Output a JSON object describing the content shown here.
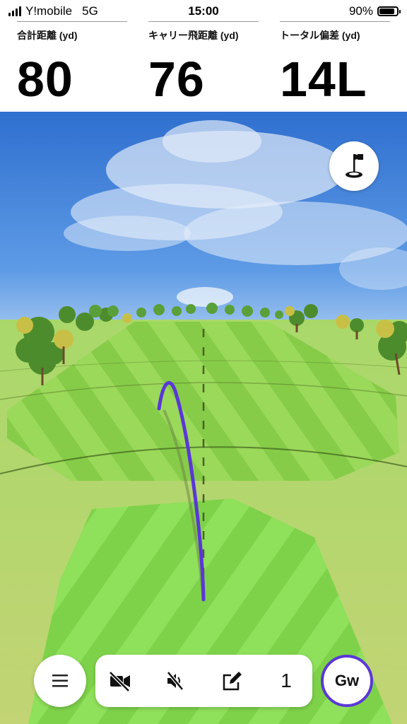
{
  "status_bar": {
    "carrier": "Y!mobile",
    "network": "5G",
    "time": "15:00",
    "battery": "90%",
    "battery_level": 0.9
  },
  "stats": [
    {
      "label": "合計距離 (yd)",
      "value": "80"
    },
    {
      "label": "キャリー飛距離 (yd)",
      "value": "76"
    },
    {
      "label": "トータル偏差 (yd)",
      "value": "14L"
    }
  ],
  "icons": {
    "flag": "golf-flag-icon",
    "menu": "hamburger-menu-icon",
    "video": "video-off-icon",
    "sound": "sound-off-icon",
    "edit": "edit-note-icon"
  },
  "toolbar": {
    "shot_count": "1"
  },
  "club": {
    "label": "Gw"
  },
  "colors": {
    "trajectory": "#5a38d6",
    "club_ring": "#5a38d6",
    "fairway": "#8fd14f",
    "sky": "#3f7fd4"
  }
}
